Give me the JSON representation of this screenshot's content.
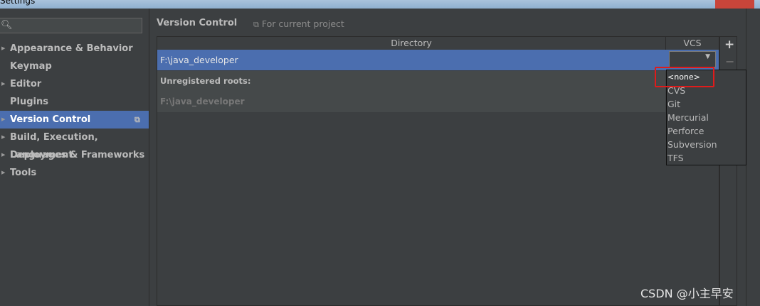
{
  "window": {
    "title": "Settings"
  },
  "sidebar": {
    "search_placeholder": "",
    "items": [
      {
        "label": "Appearance & Behavior",
        "has_arrow": true
      },
      {
        "label": "Keymap",
        "has_arrow": false
      },
      {
        "label": "Editor",
        "has_arrow": true
      },
      {
        "label": "Plugins",
        "has_arrow": false
      },
      {
        "label": "Version Control",
        "has_arrow": true,
        "selected": true
      },
      {
        "label": "Build, Execution, Deployment",
        "has_arrow": true
      },
      {
        "label": "Languages & Frameworks",
        "has_arrow": true
      },
      {
        "label": "Tools",
        "has_arrow": true
      }
    ]
  },
  "main": {
    "title": "Version Control",
    "scope_label": "For current project",
    "table": {
      "columns": [
        "Directory",
        "VCS"
      ],
      "selected_row": {
        "directory": "F:\\java_developer",
        "vcs": ""
      },
      "unregistered_label": "Unregistered roots:",
      "unregistered_dir": "F:\\java_developer"
    },
    "toolbar": {
      "add": "+",
      "remove": "−"
    }
  },
  "dropdown": {
    "options": [
      "<none>",
      "CVS",
      "Git",
      "Mercurial",
      "Perforce",
      "Subversion",
      "TFS"
    ]
  },
  "watermark": "CSDN @小主早安",
  "colors": {
    "selection": "#4b6eaf",
    "background": "#3c3f41",
    "highlight_box": "#e01b1b"
  },
  "icons": {
    "search": "search-icon",
    "scope": "project-scope-icon",
    "combo": "chevron-down-icon"
  }
}
